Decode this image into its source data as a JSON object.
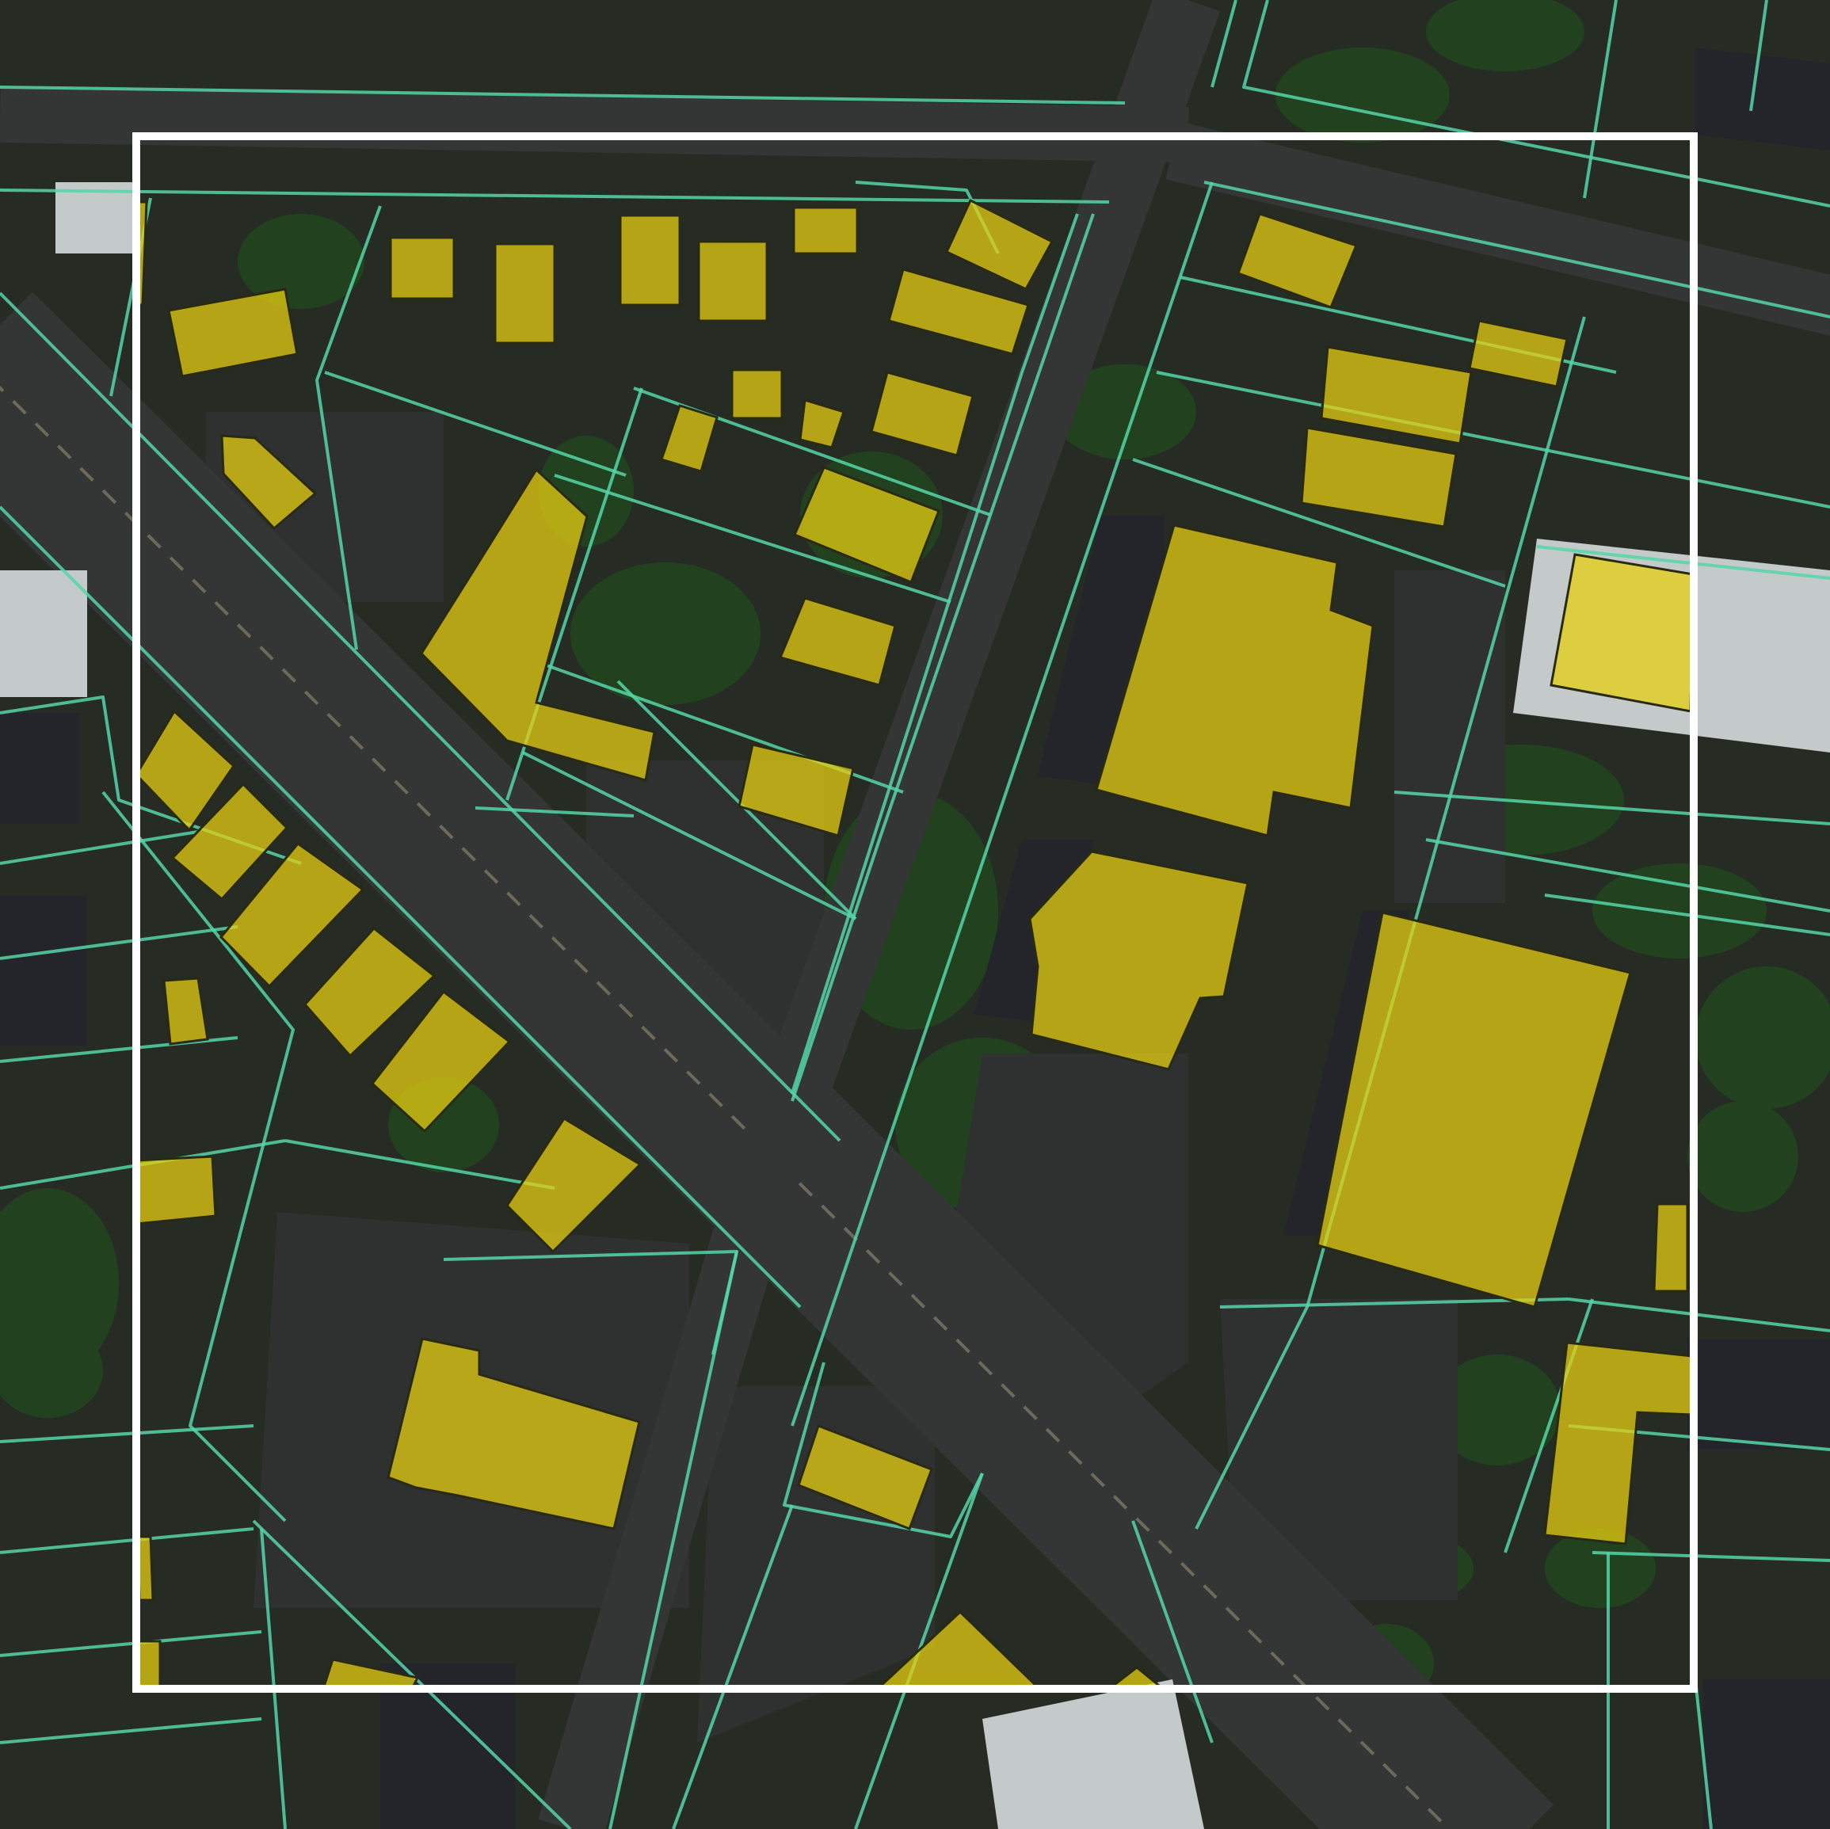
{
  "map": {
    "basemap": "aerial-imagery",
    "colors": {
      "ground": "#262b24",
      "pavement": "#2f3130",
      "road": "#343535",
      "road_marking": "#6d6a5c",
      "vegetation": "#22421f",
      "roof_light": "#c4c9c9",
      "roof_dark": "#23252a",
      "parcel_line": "#55d6a8",
      "building_fill": "#e6cf12",
      "building_stroke": "#2a2a12",
      "frame": "#ffffff"
    },
    "layers": [
      {
        "id": "imagery",
        "label": ""
      },
      {
        "id": "parcels",
        "label": ""
      },
      {
        "id": "buildings",
        "label": ""
      },
      {
        "id": "frame",
        "label": ""
      }
    ]
  }
}
